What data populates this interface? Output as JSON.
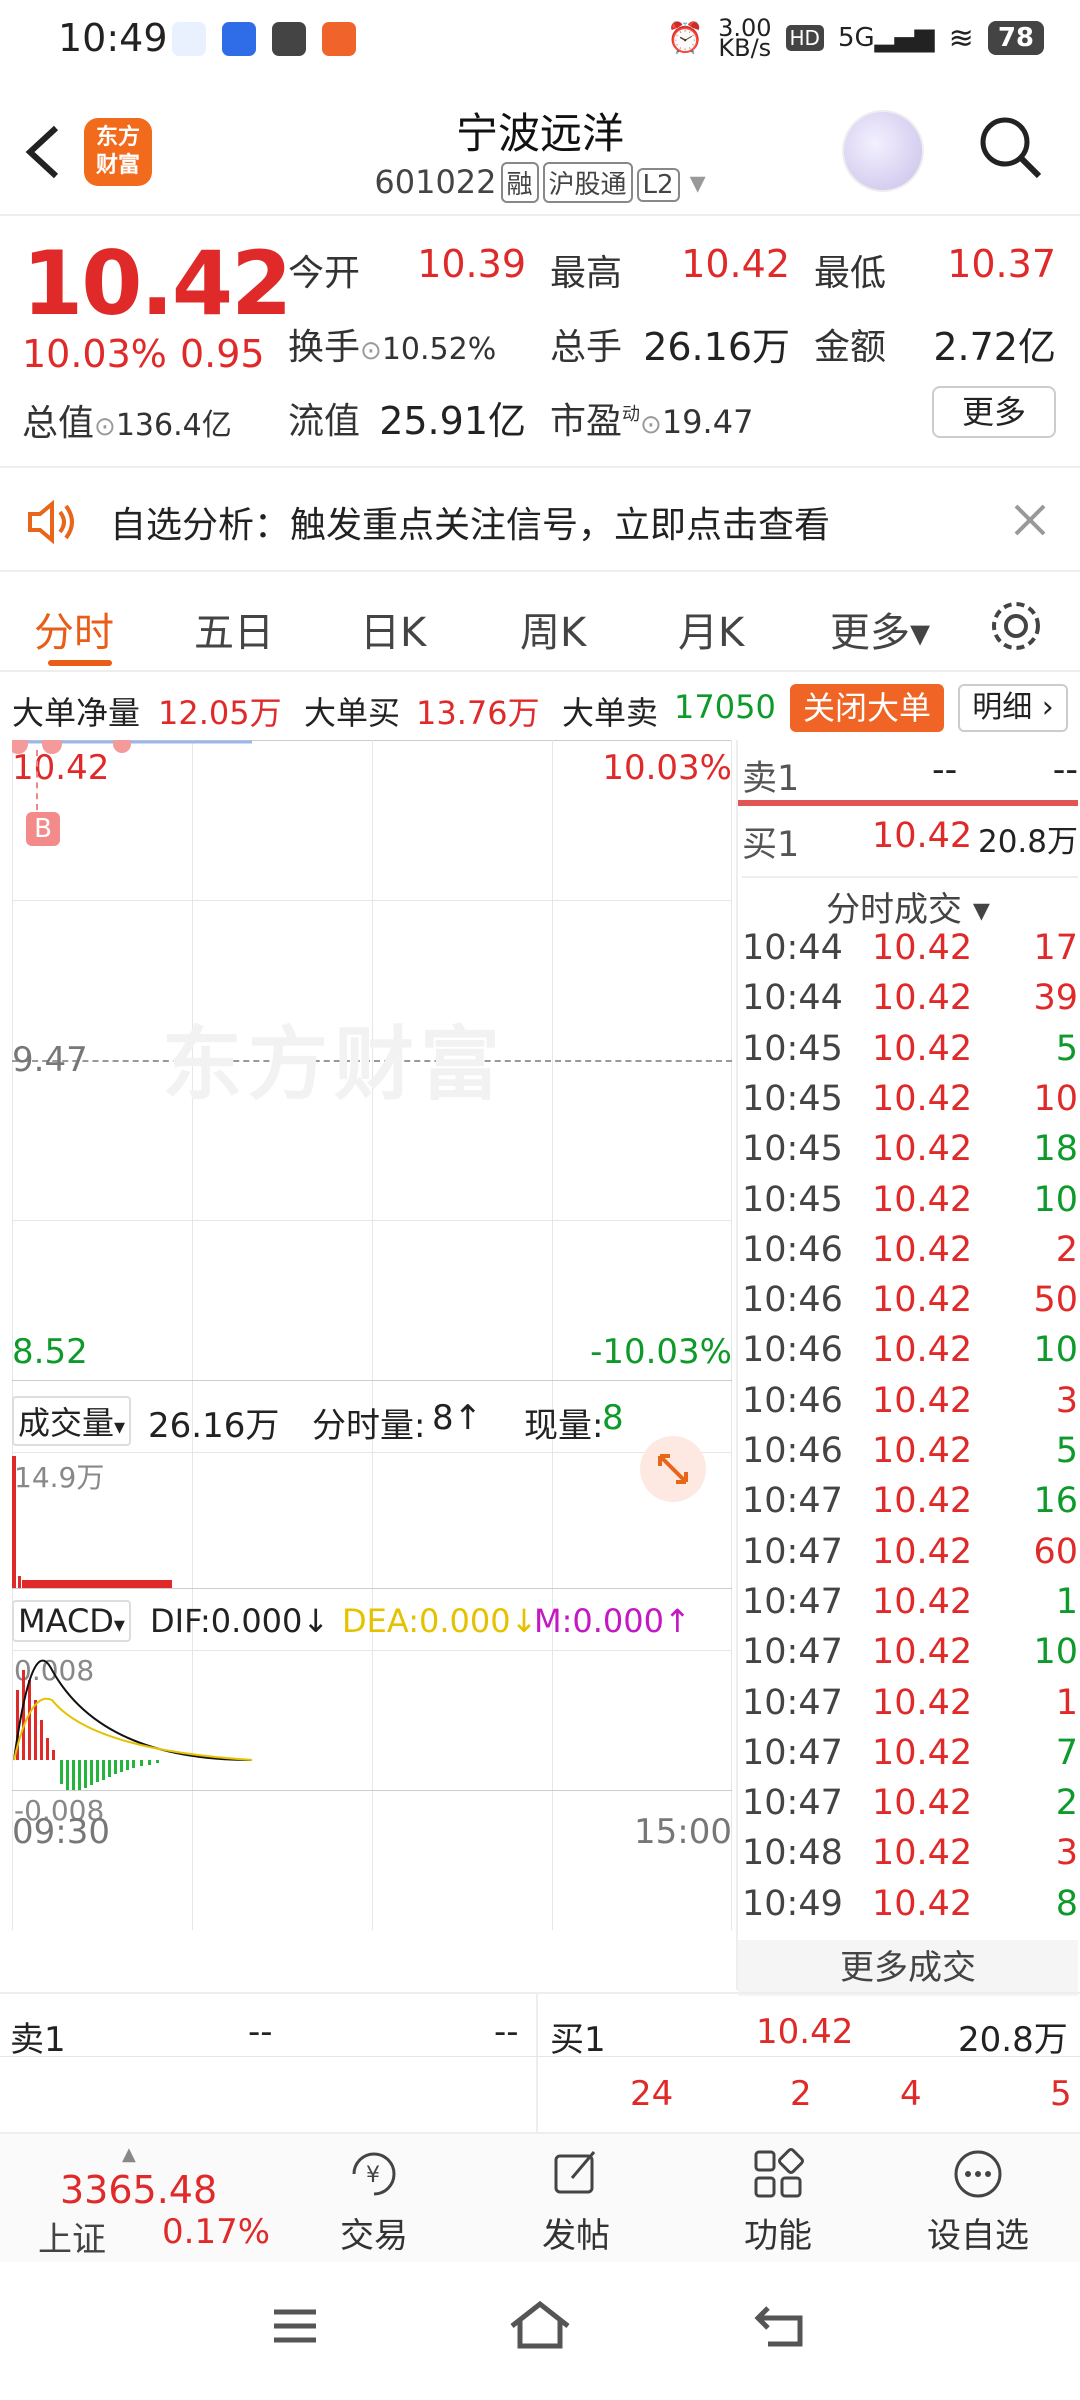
{
  "status": {
    "time": "10:49",
    "speed": "3.00\nKB/s",
    "speed_top": "3.00",
    "speed_bottom": "KB/s",
    "hd": "HD",
    "net": "5G",
    "battery": "78"
  },
  "header": {
    "logo_line1": "东方",
    "logo_line2": "财富",
    "title": "宁波远洋",
    "code": "601022",
    "tags": [
      "融",
      "沪股通",
      "L2"
    ]
  },
  "quote": {
    "price": "10.42",
    "change_pct": "10.03%",
    "change": "0.95",
    "open_label": "今开",
    "open": "10.39",
    "high_label": "最高",
    "high": "10.42",
    "low_label": "最低",
    "low": "10.37",
    "turnover_label": "换手",
    "turnover": "10.52%",
    "volume_label": "总手",
    "volume": "26.16万",
    "amount_label": "金额",
    "amount": "2.72亿",
    "mcap_label": "总值",
    "mcap": "136.4亿",
    "float_label": "流值",
    "float": "25.91亿",
    "pe_label": "市盈",
    "pe_sup": "动",
    "pe": "19.47",
    "more_label": "更多"
  },
  "banner": {
    "text": "自选分析：触发重点关注信号，立即点击查看"
  },
  "tabs": [
    {
      "label": "分时",
      "active": true
    },
    {
      "label": "五日"
    },
    {
      "label": "日K"
    },
    {
      "label": "周K"
    },
    {
      "label": "月K"
    },
    {
      "label": "更多▾"
    }
  ],
  "bigorder": {
    "net_label": "大单净量",
    "net": "12.05万",
    "buy_label": "大单买",
    "buy": "13.76万",
    "sell_label": "大单卖",
    "sell": "17050",
    "close_label": "关闭大单",
    "detail_label": "明细 ›"
  },
  "chart": {
    "price_top": "10.42",
    "pct_top": "10.03%",
    "prev_close": "9.47",
    "price_bottom": "8.52",
    "pct_bottom": "-10.03%",
    "marker": "B",
    "watermark": "东方财富",
    "vol_label": "成交量",
    "vol_total": "26.16万",
    "vol_tick_label": "分时量:",
    "vol_tick": "8↑",
    "vol_now_label": "现量:",
    "vol_now": "8",
    "vol_max": "14.9万",
    "macd_label": "MACD",
    "dif": "DIF:0.000↓",
    "dea": "DEA:0.000↓",
    "m": "M:0.000↑",
    "macd_top": "0.008",
    "macd_bottom": "-0.008",
    "time_start": "09:30",
    "time_end": "15:00"
  },
  "chart_data": {
    "type": "line",
    "x": [
      "09:30",
      "15:00"
    ],
    "ylim": [
      8.52,
      10.42
    ],
    "series": [],
    "prev_close": 9.47
  },
  "depth": {
    "sell1_label": "卖1",
    "sell1_price": "--",
    "sell1_vol": "--",
    "buy1_label": "买1",
    "buy1_price": "10.42",
    "buy1_vol": "20.8万"
  },
  "trades_label": "分时成交 ▾",
  "trades": [
    [
      "10:44",
      "10.42",
      "17"
    ],
    [
      "10:44",
      "10.42",
      "39"
    ],
    [
      "10:45",
      "10.42",
      "5"
    ],
    [
      "10:45",
      "10.42",
      "10"
    ],
    [
      "10:45",
      "10.42",
      "18"
    ],
    [
      "10:45",
      "10.42",
      "10"
    ],
    [
      "10:46",
      "10.42",
      "2"
    ],
    [
      "10:46",
      "10.42",
      "50"
    ],
    [
      "10:46",
      "10.42",
      "10"
    ],
    [
      "10:46",
      "10.42",
      "3"
    ],
    [
      "10:46",
      "10.42",
      "5"
    ],
    [
      "10:47",
      "10.42",
      "16"
    ],
    [
      "10:47",
      "10.42",
      "60"
    ],
    [
      "10:47",
      "10.42",
      "1"
    ],
    [
      "10:47",
      "10.42",
      "10"
    ],
    [
      "10:47",
      "10.42",
      "1"
    ],
    [
      "10:47",
      "10.42",
      "7"
    ],
    [
      "10:47",
      "10.42",
      "2"
    ],
    [
      "10:48",
      "10.42",
      "3"
    ],
    [
      "10:49",
      "10.42",
      "8"
    ]
  ],
  "more_trades": "更多成交",
  "obook": {
    "sell1_label": "卖1",
    "sell1_price": "--",
    "sell1_vol": "--",
    "buy1_label": "买1",
    "buy1_price": "10.42",
    "buy1_vol": "20.8万",
    "row2": [
      "24",
      "2",
      "4",
      "5"
    ]
  },
  "toolbar": {
    "index_value": "3365.48",
    "index_name": "上证",
    "index_pct": "0.17%",
    "trade": "交易",
    "post": "发帖",
    "func": "功能",
    "watch": "设自选"
  },
  "colors": {
    "up": "#e02a2a",
    "down": "#0e9a2b",
    "accent": "#e85d17"
  }
}
